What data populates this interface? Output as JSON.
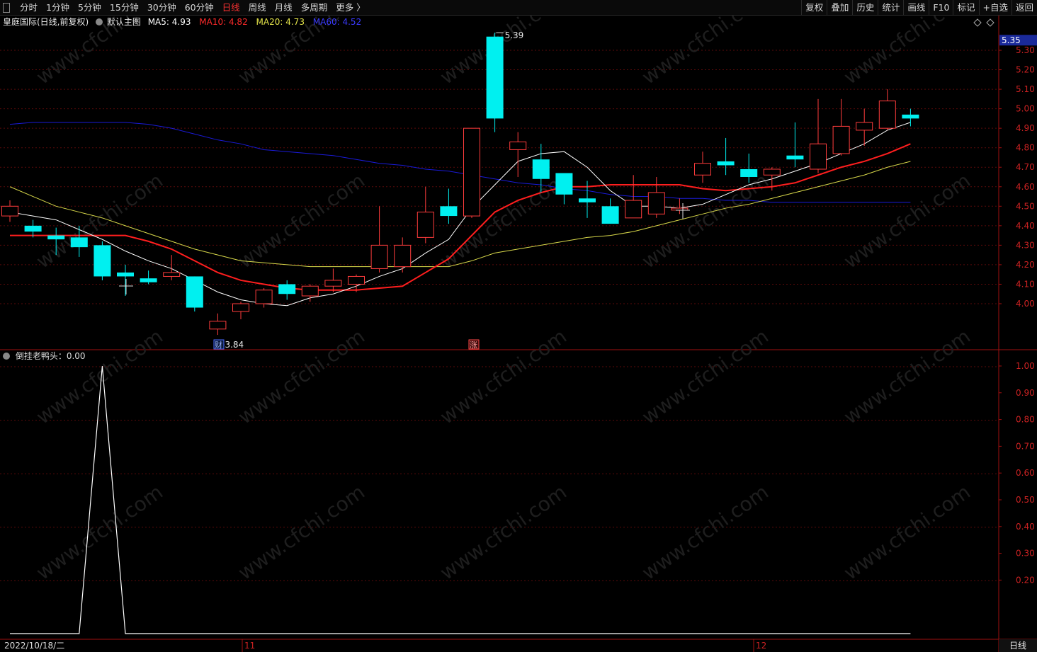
{
  "toolbar": {
    "periods": [
      {
        "label": "分时",
        "active": false
      },
      {
        "label": "1分钟",
        "active": false
      },
      {
        "label": "5分钟",
        "active": false
      },
      {
        "label": "15分钟",
        "active": false
      },
      {
        "label": "30分钟",
        "active": false
      },
      {
        "label": "60分钟",
        "active": false
      },
      {
        "label": "日线",
        "active": true
      },
      {
        "label": "周线",
        "active": false
      },
      {
        "label": "月线",
        "active": false
      },
      {
        "label": "多周期",
        "active": false
      },
      {
        "label": "更多 〉",
        "active": false
      }
    ],
    "tools": [
      "复权",
      "叠加",
      "历史",
      "统计",
      "画线",
      "F10",
      "标记",
      "+自选",
      "返回"
    ]
  },
  "main_info": {
    "title": "皇庭国际(日线,前复权)",
    "template": "默认主图",
    "ma5": "MA5: 4.93",
    "ma10": "MA10: 4.82",
    "ma20": "MA20: 4.73",
    "ma60": "MA60: 4.52",
    "colors": {
      "ma5": "#ffffff",
      "ma10": "#ff2a2a",
      "ma20": "#e6e64a",
      "ma60": "#2a2aff"
    }
  },
  "sub_info": {
    "title": "倒挂老鸭头：0.00"
  },
  "price_axis": {
    "current_tag": "5.35",
    "ticks": [
      "5.30",
      "5.20",
      "5.10",
      "5.00",
      "4.90",
      "4.80",
      "4.70",
      "4.60",
      "4.50",
      "4.40",
      "4.30",
      "4.20",
      "4.10",
      "4.00"
    ]
  },
  "sub_axis": {
    "ticks": [
      "1.00",
      "0.90",
      "0.80",
      "0.70",
      "0.60",
      "0.50",
      "0.40",
      "0.30",
      "0.20"
    ]
  },
  "annotations": {
    "high": "5.39",
    "low": "3.84",
    "event_cai": "财",
    "event_zhang": "涨"
  },
  "time_axis": {
    "start_date": "2022/10/18/二",
    "month_11": "11",
    "month_12": "12",
    "period_badge": "日线"
  },
  "watermark": "www.cfchi.com",
  "chart_data": {
    "type": "candlestick",
    "title": "皇庭国际(日线,前复权)",
    "ylim": [
      3.8,
      5.45
    ],
    "candles": [
      {
        "o": 4.45,
        "h": 4.53,
        "l": 4.42,
        "c": 4.5
      },
      {
        "o": 4.4,
        "h": 4.43,
        "l": 4.34,
        "c": 4.37
      },
      {
        "o": 4.35,
        "h": 4.39,
        "l": 4.25,
        "c": 4.33
      },
      {
        "o": 4.34,
        "h": 4.4,
        "l": 4.24,
        "c": 4.29
      },
      {
        "o": 4.3,
        "h": 4.32,
        "l": 4.12,
        "c": 4.14
      },
      {
        "o": 4.16,
        "h": 4.2,
        "l": 4.04,
        "c": 4.14
      },
      {
        "o": 4.13,
        "h": 4.17,
        "l": 4.1,
        "c": 4.11
      },
      {
        "o": 4.14,
        "h": 4.25,
        "l": 4.12,
        "c": 4.16
      },
      {
        "o": 4.14,
        "h": 4.14,
        "l": 3.96,
        "c": 3.98
      },
      {
        "o": 3.87,
        "h": 3.95,
        "l": 3.84,
        "c": 3.91
      },
      {
        "o": 3.96,
        "h": 4.01,
        "l": 3.92,
        "c": 4.0
      },
      {
        "o": 4.0,
        "h": 4.08,
        "l": 3.98,
        "c": 4.07
      },
      {
        "o": 4.1,
        "h": 4.12,
        "l": 4.02,
        "c": 4.05
      },
      {
        "o": 4.04,
        "h": 4.1,
        "l": 4.01,
        "c": 4.09
      },
      {
        "o": 4.09,
        "h": 4.18,
        "l": 4.06,
        "c": 4.12
      },
      {
        "o": 4.1,
        "h": 4.15,
        "l": 4.06,
        "c": 4.14
      },
      {
        "o": 4.18,
        "h": 4.5,
        "l": 4.16,
        "c": 4.3
      },
      {
        "o": 4.19,
        "h": 4.34,
        "l": 4.16,
        "c": 4.3
      },
      {
        "o": 4.34,
        "h": 4.6,
        "l": 4.31,
        "c": 4.47
      },
      {
        "o": 4.5,
        "h": 4.59,
        "l": 4.41,
        "c": 4.45
      },
      {
        "o": 4.45,
        "h": 4.9,
        "l": 4.44,
        "c": 4.9
      },
      {
        "o": 5.37,
        "h": 5.39,
        "l": 4.88,
        "c": 4.95
      },
      {
        "o": 4.79,
        "h": 4.88,
        "l": 4.65,
        "c": 4.83
      },
      {
        "o": 4.74,
        "h": 4.82,
        "l": 4.57,
        "c": 4.64
      },
      {
        "o": 4.67,
        "h": 4.67,
        "l": 4.51,
        "c": 4.56
      },
      {
        "o": 4.54,
        "h": 4.63,
        "l": 4.44,
        "c": 4.52
      },
      {
        "o": 4.5,
        "h": 4.54,
        "l": 4.41,
        "c": 4.41
      },
      {
        "o": 4.44,
        "h": 4.66,
        "l": 4.44,
        "c": 4.53
      },
      {
        "o": 4.46,
        "h": 4.65,
        "l": 4.44,
        "c": 4.57
      },
      {
        "o": 4.48,
        "h": 4.54,
        "l": 4.46,
        "c": 4.49
      },
      {
        "o": 4.66,
        "h": 4.78,
        "l": 4.62,
        "c": 4.72
      },
      {
        "o": 4.73,
        "h": 4.85,
        "l": 4.66,
        "c": 4.71
      },
      {
        "o": 4.69,
        "h": 4.77,
        "l": 4.62,
        "c": 4.65
      },
      {
        "o": 4.66,
        "h": 4.7,
        "l": 4.58,
        "c": 4.69
      },
      {
        "o": 4.76,
        "h": 4.93,
        "l": 4.7,
        "c": 4.74
      },
      {
        "o": 4.69,
        "h": 5.05,
        "l": 4.67,
        "c": 4.82
      },
      {
        "o": 4.77,
        "h": 5.05,
        "l": 4.76,
        "c": 4.91
      },
      {
        "o": 4.89,
        "h": 5.0,
        "l": 4.81,
        "c": 4.93
      },
      {
        "o": 4.9,
        "h": 5.1,
        "l": 4.89,
        "c": 5.04
      },
      {
        "o": 4.97,
        "h": 5.0,
        "l": 4.91,
        "c": 4.95
      }
    ],
    "ma5": [
      4.47,
      4.45,
      4.43,
      4.38,
      4.33,
      4.27,
      4.22,
      4.18,
      4.12,
      4.06,
      4.02,
      4.0,
      3.99,
      4.03,
      4.05,
      4.09,
      4.14,
      4.18,
      4.26,
      4.33,
      4.49,
      4.61,
      4.73,
      4.77,
      4.78,
      4.7,
      4.58,
      4.5,
      4.5,
      4.49,
      4.51,
      4.56,
      4.61,
      4.64,
      4.68,
      4.72,
      4.77,
      4.82,
      4.89,
      4.93
    ],
    "ma10": [
      4.35,
      4.35,
      4.35,
      4.35,
      4.35,
      4.35,
      4.32,
      4.28,
      4.22,
      4.16,
      4.12,
      4.1,
      4.08,
      4.07,
      4.07,
      4.07,
      4.08,
      4.09,
      4.16,
      4.23,
      4.35,
      4.47,
      4.53,
      4.57,
      4.6,
      4.6,
      4.61,
      4.61,
      4.61,
      4.61,
      4.59,
      4.58,
      4.59,
      4.6,
      4.62,
      4.66,
      4.7,
      4.73,
      4.77,
      4.82
    ],
    "ma20": [
      4.6,
      4.55,
      4.5,
      4.47,
      4.44,
      4.4,
      4.36,
      4.32,
      4.28,
      4.25,
      4.22,
      4.21,
      4.2,
      4.19,
      4.19,
      4.19,
      4.19,
      4.19,
      4.19,
      4.19,
      4.22,
      4.26,
      4.28,
      4.3,
      4.32,
      4.34,
      4.35,
      4.37,
      4.4,
      4.43,
      4.46,
      4.49,
      4.51,
      4.54,
      4.57,
      4.6,
      4.63,
      4.66,
      4.7,
      4.73
    ],
    "ma60": [
      4.92,
      4.93,
      4.93,
      4.93,
      4.93,
      4.93,
      4.92,
      4.9,
      4.87,
      4.84,
      4.82,
      4.79,
      4.78,
      4.77,
      4.76,
      4.74,
      4.72,
      4.71,
      4.69,
      4.68,
      4.66,
      4.64,
      4.62,
      4.61,
      4.59,
      4.58,
      4.56,
      4.55,
      4.55,
      4.54,
      4.54,
      4.53,
      4.53,
      4.52,
      4.52,
      4.52,
      4.52,
      4.52,
      4.52,
      4.52
    ],
    "indicator": {
      "name": "倒挂老鸭头",
      "ylim": [
        0,
        1.05
      ],
      "values": [
        0,
        0,
        0,
        0,
        1,
        0,
        0,
        0,
        0,
        0,
        0,
        0,
        0,
        0,
        0,
        0,
        0,
        0,
        0,
        0,
        0,
        0,
        0,
        0,
        0,
        0,
        0,
        0,
        0,
        0,
        0,
        0,
        0,
        0,
        0,
        0,
        0,
        0,
        0,
        0
      ]
    }
  }
}
